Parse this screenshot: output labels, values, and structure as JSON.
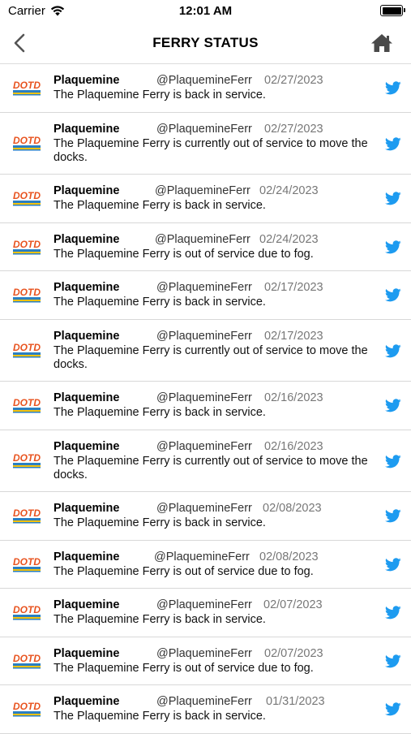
{
  "status_bar": {
    "carrier": "Carrier",
    "time": "12:01 AM"
  },
  "nav": {
    "title": "FERRY STATUS",
    "back_icon": "chevron-left-icon",
    "home_icon": "home-icon"
  },
  "feed": {
    "logo_text": "DOTD",
    "items": [
      {
        "name": "Plaquemine",
        "handle": "@PlaquemineFerr",
        "date": "02/27/2023",
        "text": "The Plaquemine Ferry is back in service."
      },
      {
        "name": "Plaquemine",
        "handle": "@PlaquemineFerr",
        "date": "02/27/2023",
        "text": "The Plaquemine Ferry is currently out of service to move the docks."
      },
      {
        "name": "Plaquemine",
        "handle": "@PlaquemineFerr",
        "date": "02/24/2023",
        "text": "The Plaquemine Ferry is back in service."
      },
      {
        "name": "Plaquemine",
        "handle": "@PlaquemineFerr",
        "date": "02/24/2023",
        "text": "The Plaquemine Ferry is out of service due to fog."
      },
      {
        "name": "Plaquemine",
        "handle": "@PlaquemineFerr",
        "date": "02/17/2023",
        "text": "The Plaquemine Ferry is back in service."
      },
      {
        "name": "Plaquemine",
        "handle": "@PlaquemineFerr",
        "date": "02/17/2023",
        "text": "The Plaquemine Ferry is currently out of service to move the docks."
      },
      {
        "name": "Plaquemine",
        "handle": "@PlaquemineFerr",
        "date": "02/16/2023",
        "text": "The Plaquemine Ferry is back in service."
      },
      {
        "name": "Plaquemine",
        "handle": "@PlaquemineFerr",
        "date": "02/16/2023",
        "text": "The Plaquemine Ferry is currently out of service to move the docks."
      },
      {
        "name": "Plaquemine",
        "handle": "@PlaquemineFerr",
        "date": "02/08/2023",
        "text": "The Plaquemine Ferry is back in service."
      },
      {
        "name": "Plaquemine",
        "handle": "@PlaquemineFerr",
        "date": "02/08/2023",
        "text": "The Plaquemine Ferry is out of service due to fog."
      },
      {
        "name": "Plaquemine",
        "handle": "@PlaquemineFerr",
        "date": "02/07/2023",
        "text": "The Plaquemine  Ferry is back in service."
      },
      {
        "name": "Plaquemine",
        "handle": "@PlaquemineFerr",
        "date": "02/07/2023",
        "text": "The Plaquemine Ferry is out of service due to fog."
      },
      {
        "name": "Plaquemine",
        "handle": "@PlaquemineFerr",
        "date": "01/31/2023",
        "text": "The Plaquemine  Ferry is back in service."
      }
    ]
  },
  "colors": {
    "twitter": "#1d9bf0",
    "logo_orange": "#e8531f",
    "logo_blue": "#2a7fc1",
    "logo_yellow": "#f4c20d"
  }
}
